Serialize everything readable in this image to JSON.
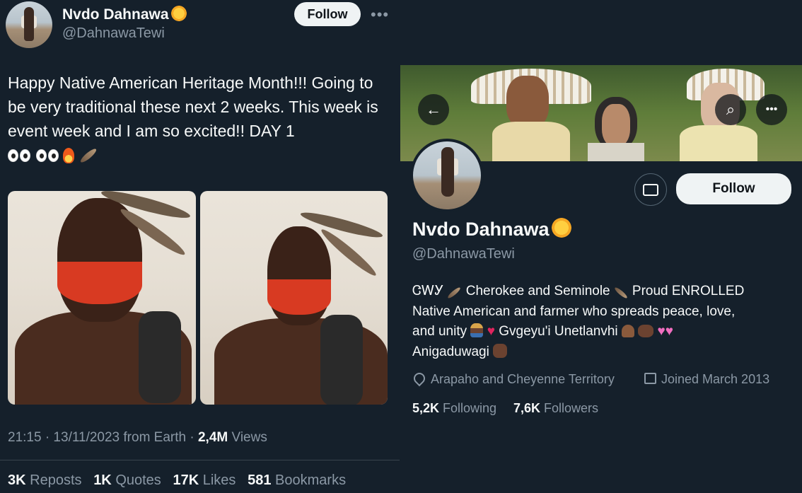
{
  "tweet": {
    "author_name": "Nvdo Dahnawa",
    "author_handle": "@DahnawaTewi",
    "follow_label": "Follow",
    "more_icon": "•••",
    "text": "Happy Native American Heritage Month!!! Going to be very traditional these next 2 weeks. This week is event week and I am so excited!! DAY 1",
    "time": "21:15 · 13/11/2023 from Earth · ",
    "views_count": "2,4M",
    "views_label": " Views",
    "stats": [
      {
        "count": "3K",
        "label": " Reposts"
      },
      {
        "count": "1K",
        "label": " Quotes"
      },
      {
        "count": "17K",
        "label": " Likes"
      },
      {
        "count": "581",
        "label": " Bookmarks"
      }
    ]
  },
  "profile": {
    "back_icon": "←",
    "search_icon": "⌕",
    "more_icon": "•••",
    "follow_label": "Follow",
    "name": "Nvdo Dahnawa",
    "handle": "@DahnawaTewi",
    "bio_line1_a": "ᏣᎳᎩ",
    "bio_line1_b": " Cherokee and Seminole",
    "bio_line1_c": " Proud ENROLLED",
    "bio_line2": "Native American and farmer who spreads peace, love,",
    "bio_line3_a": "and unity",
    "bio_line3_b": " Gvgeyu'i Unetlanvhi",
    "bio_line4": "Anigaduwagi",
    "location": "Arapaho and Cheyenne Territory",
    "joined": "Joined March 2013",
    "following_count": "5,2K",
    "following_label": " Following",
    "followers_count": "7,6K",
    "followers_label": " Followers"
  },
  "colors": {
    "background": "#15202b",
    "secondary_text": "#8b98a5",
    "button_bg": "#eff3f4"
  }
}
